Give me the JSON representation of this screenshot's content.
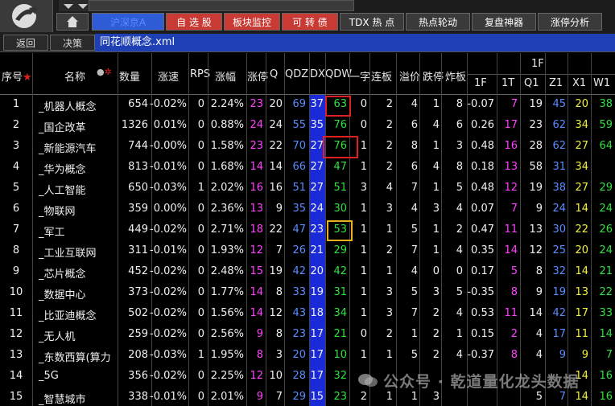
{
  "nav": {
    "tabs": [
      {
        "label": "沪深京A",
        "style": "blue",
        "w": 0
      },
      {
        "label": "自 选 股",
        "style": "red"
      },
      {
        "label": "板块监控",
        "style": "red"
      },
      {
        "label": "可 转 债",
        "style": "red"
      },
      {
        "label": "TDX 热 点",
        "style": "dark"
      },
      {
        "label": "热点轮动",
        "style": "dark"
      },
      {
        "label": "复盘神器",
        "style": "dark"
      },
      {
        "label": "涨停分析",
        "style": "dark"
      }
    ]
  },
  "toolbar": {
    "back_label": "返回",
    "decision_label": "决策",
    "filename": "同花顺概念.xml"
  },
  "headers": {
    "seq": "序号",
    "name": "名称",
    "qty": "数量",
    "speed": "涨速",
    "rps": "RPS",
    "pct": "涨幅",
    "zt": "涨停",
    "q": "Q",
    "qdz": "QDZ",
    "dx": "DX",
    "qdw": "QDW",
    "yizi": "一字",
    "lianban": "连板",
    "yijia": "溢价",
    "dieting": "跌停",
    "zhaban": "炸板",
    "group_1f": "1F",
    "f1": "1F",
    "t1": "1T",
    "q1": "Q1",
    "z1": "Z1",
    "x1": "X1",
    "w1": "W1"
  },
  "rows": [
    {
      "seq": "1",
      "name": "_机器人概念",
      "qty": "654",
      "speed": "-0.02%",
      "rps": "0",
      "pct": "2.24%",
      "zt": "23",
      "q": "20",
      "qdz": "69",
      "dx": "37",
      "qdw": "63",
      "yizi": "0",
      "lianban": "2",
      "yijia": "4",
      "dieting": "1",
      "zhaban": "8",
      "f1": "-0.07",
      "t1": "7",
      "q1": "19",
      "z1": "45",
      "x1": "20",
      "w1": "38"
    },
    {
      "seq": "2",
      "name": "_国企改革",
      "qty": "1326",
      "speed": "0.01%",
      "rps": "0",
      "pct": "0.88%",
      "zt": "24",
      "q": "24",
      "qdz": "55",
      "dx": "35",
      "qdw": "76",
      "yizi": "0",
      "lianban": "2",
      "yijia": "6",
      "dieting": "4",
      "zhaban": "6",
      "f1": "0.26",
      "t1": "17",
      "q1": "23",
      "z1": "62",
      "x1": "34",
      "w1": "59"
    },
    {
      "seq": "3",
      "name": "_新能源汽车",
      "qty": "744",
      "speed": "-0.00%",
      "rps": "0",
      "pct": "1.58%",
      "zt": "23",
      "q": "22",
      "qdz": "70",
      "dx": "27",
      "qdw": "76",
      "yizi": "1",
      "lianban": "2",
      "yijia": "8",
      "dieting": "1",
      "zhaban": "3",
      "f1": "0.48",
      "t1": "16",
      "q1": "28",
      "z1": "62",
      "x1": "27",
      "w1": "64"
    },
    {
      "seq": "4",
      "name": "_华为概念",
      "qty": "813",
      "speed": "-0.01%",
      "rps": "0",
      "pct": "1.68%",
      "zt": "14",
      "q": "14",
      "qdz": "66",
      "dx": "27",
      "qdw": "47",
      "yizi": "1",
      "lianban": "2",
      "yijia": "6",
      "dieting": "4",
      "zhaban": "8",
      "f1": "0.18",
      "t1": "13",
      "q1": "58",
      "z1": "31",
      "x1": "34",
      "w1": ""
    },
    {
      "seq": "5",
      "name": "_人工智能",
      "qty": "650",
      "speed": "-0.03%",
      "rps": "1",
      "pct": "2.02%",
      "zt": "16",
      "q": "16",
      "qdz": "51",
      "dx": "27",
      "qdw": "51",
      "yizi": "3",
      "lianban": "4",
      "yijia": "7",
      "dieting": "1",
      "zhaban": "5",
      "f1": "0.48",
      "t1": "12",
      "q1": "19",
      "z1": "38",
      "x1": "27",
      "w1": "29"
    },
    {
      "seq": "6",
      "name": "_物联网",
      "qty": "359",
      "speed": "0.00%",
      "rps": "0",
      "pct": "2.36%",
      "zt": "13",
      "q": "9",
      "qdz": "35",
      "dx": "24",
      "qdw": "30",
      "yizi": "1",
      "lianban": "3",
      "yijia": "4",
      "dieting": "3",
      "zhaban": "4",
      "f1": "0.07",
      "t1": "7",
      "q1": "9",
      "z1": "24",
      "x1": "14",
      "w1": "24"
    },
    {
      "seq": "7",
      "name": "_军工",
      "qty": "449",
      "speed": "-0.02%",
      "rps": "0",
      "pct": "2.71%",
      "zt": "18",
      "q": "22",
      "qdz": "47",
      "dx": "23",
      "qdw": "53",
      "yizi": "1",
      "lianban": "1",
      "yijia": "5",
      "dieting": "1",
      "zhaban": "2",
      "f1": "0.47",
      "t1": "11",
      "q1": "13",
      "z1": "30",
      "x1": "22",
      "w1": "26"
    },
    {
      "seq": "8",
      "name": "_工业互联网",
      "qty": "311",
      "speed": "-0.01%",
      "rps": "0",
      "pct": "1.93%",
      "zt": "12",
      "q": "7",
      "qdz": "26",
      "dx": "21",
      "qdw": "29",
      "yizi": "1",
      "lianban": "2",
      "yijia": "7",
      "dieting": "1",
      "zhaban": "4",
      "f1": "0.35",
      "t1": "14",
      "q1": "12",
      "z1": "25",
      "x1": "20",
      "w1": "24"
    },
    {
      "seq": "9",
      "name": "_芯片概念",
      "qty": "452",
      "speed": "-0.02%",
      "rps": "0",
      "pct": "2.48%",
      "zt": "15",
      "q": "19",
      "qdz": "42",
      "dx": "20",
      "qdw": "42",
      "yizi": "1",
      "lianban": "1",
      "yijia": "4",
      "dieting": "0",
      "zhaban": "0",
      "f1": "0.17",
      "t1": "5",
      "q1": "8",
      "z1": "32",
      "x1": "14",
      "w1": "21"
    },
    {
      "seq": "10",
      "name": "_数据中心",
      "qty": "373",
      "speed": "-0.02%",
      "rps": "0",
      "pct": "1.77%",
      "zt": "14",
      "q": "8",
      "qdz": "33",
      "dx": "19",
      "qdw": "31",
      "yizi": "1",
      "lianban": "3",
      "yijia": "5",
      "dieting": "3",
      "zhaban": "5",
      "f1": "-0.35",
      "t1": "8",
      "q1": "9",
      "z1": "19",
      "x1": "13",
      "w1": "22"
    },
    {
      "seq": "11",
      "name": "_比亚迪概念",
      "qty": "502",
      "speed": "-0.02%",
      "rps": "0",
      "pct": "1.56%",
      "zt": "14",
      "q": "12",
      "qdz": "43",
      "dx": "18",
      "qdw": "34",
      "yizi": "1",
      "lianban": "3",
      "yijia": "7",
      "dieting": "2",
      "zhaban": "4",
      "f1": "0.53",
      "t1": "11",
      "q1": "14",
      "z1": "42",
      "x1": "17",
      "w1": "33"
    },
    {
      "seq": "12",
      "name": "_无人机",
      "qty": "259",
      "speed": "-0.02%",
      "rps": "0",
      "pct": "2.56%",
      "zt": "9",
      "q": "8",
      "qdz": "23",
      "dx": "17",
      "qdw": "21",
      "yizi": "0",
      "lianban": "2",
      "yijia": "1",
      "dieting": "2",
      "zhaban": "1",
      "f1": "0.15",
      "t1": "2",
      "q1": "4",
      "z1": "17",
      "x1": "11",
      "w1": "14"
    },
    {
      "seq": "13",
      "name": "_东数西算(算力",
      "qty": "208",
      "speed": "-0.03%",
      "rps": "1",
      "pct": "1.95%",
      "zt": "8",
      "q": "3",
      "qdz": "20",
      "dx": "17",
      "qdw": "10",
      "yizi": "1",
      "lianban": "1",
      "yijia": "5",
      "dieting": "2",
      "zhaban": "4",
      "f1": "-0.37",
      "t1": "8",
      "q1": "4",
      "z1": "9",
      "x1": "9",
      "w1": "7"
    },
    {
      "seq": "14",
      "name": "_5G",
      "qty": "356",
      "speed": "-0.02%",
      "rps": "0",
      "pct": "2.25%",
      "zt": "12",
      "q": "10",
      "qdz": "28",
      "dx": "17",
      "qdw": "32",
      "yizi": "",
      "lianban": "",
      "yijia": "",
      "dieting": "",
      "zhaban": "",
      "f1": "",
      "t1": "",
      "q1": "",
      "z1": "",
      "x1": "14",
      "w1": "16"
    },
    {
      "seq": "15",
      "name": "_智慧城市",
      "qty": "338",
      "speed": "-0.01%",
      "rps": "0",
      "pct": "2.01%",
      "zt": "9",
      "q": "7",
      "qdz": "29",
      "dx": "15",
      "qdw": "23",
      "yizi": "2",
      "lianban": "1",
      "yijia": "1",
      "dieting": "3",
      "zhaban": "",
      "f1": "",
      "t1": "",
      "q1": "5",
      "z1": "7",
      "x1": "14",
      "w1": "16"
    }
  ],
  "watermark": "公众号 · 乾道量化龙头数据",
  "colors": {
    "accent_blue": "#1f3fb5",
    "dx_column": "#1a2ad8",
    "tab_red": "#c93a34",
    "highlight_red": "#e02020",
    "highlight_yellow": "#e8b020"
  }
}
